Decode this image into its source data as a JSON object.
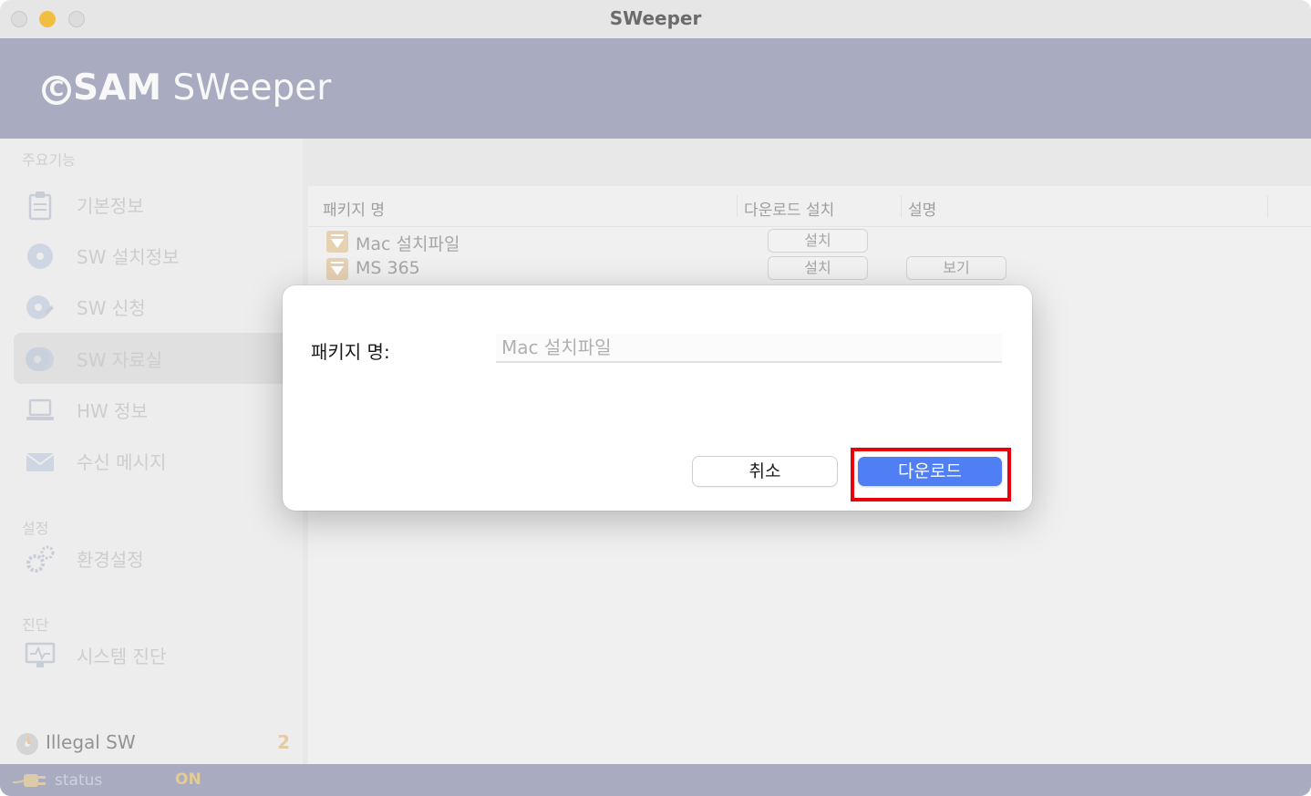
{
  "window": {
    "title": "SWeeper"
  },
  "header": {
    "logo_mark": "C",
    "logo_bold": "SAM",
    "logo_light": " SWeeper"
  },
  "sidebar": {
    "section_main": "주요기능",
    "items": [
      {
        "label": "기본정보",
        "icon": "clipboard-icon"
      },
      {
        "label": "SW 설치정보",
        "icon": "disc-icon"
      },
      {
        "label": "SW 신청",
        "icon": "disc-edit-icon"
      },
      {
        "label": "SW 자료실",
        "icon": "disc-stack-icon"
      },
      {
        "label": "HW 정보",
        "icon": "laptop-icon"
      },
      {
        "label": "수신 메시지",
        "icon": "envelope-icon"
      }
    ],
    "section_settings": "설정",
    "settings_item": {
      "label": "환경설정",
      "icon": "gears-icon"
    },
    "section_diag": "진단",
    "diag_item": {
      "label": "시스템 진단",
      "icon": "monitor-pulse-icon"
    },
    "illegal": {
      "label": "Illegal SW",
      "count": "2"
    }
  },
  "statusbar": {
    "label": "status",
    "value": "ON"
  },
  "table": {
    "headers": [
      "패키지 명",
      "다운로드 설치",
      "설명"
    ],
    "rows": [
      {
        "name": "Mac 설치파일",
        "install": "설치",
        "desc": ""
      },
      {
        "name": "MS 365",
        "install": "설치",
        "desc": "보기"
      }
    ]
  },
  "dialog": {
    "label": "패키지 명:",
    "placeholder": "Mac 설치파일",
    "cancel": "취소",
    "confirm": "다운로드"
  }
}
